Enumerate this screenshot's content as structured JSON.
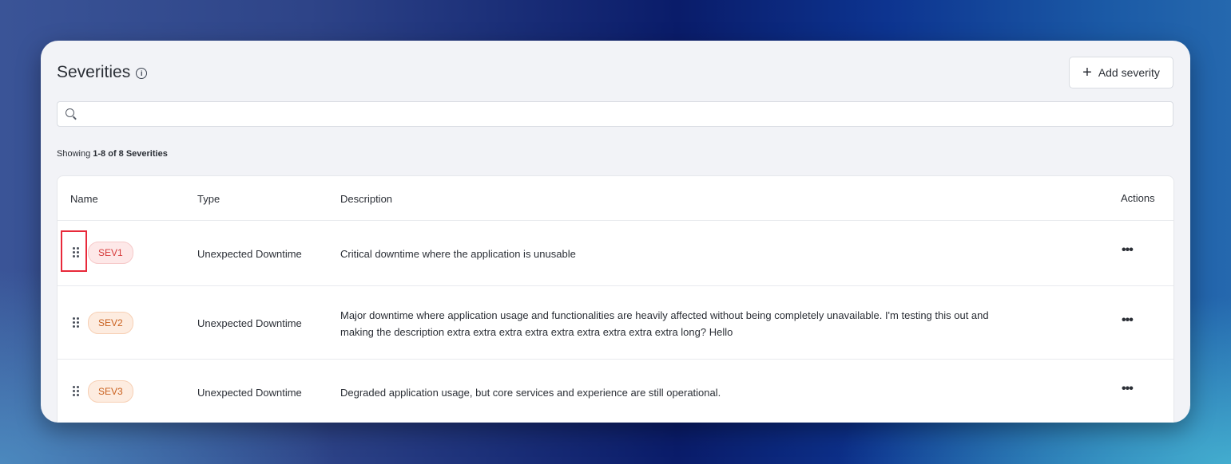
{
  "header": {
    "title": "Severities",
    "add_button_label": "Add severity"
  },
  "search": {
    "placeholder": "",
    "value": ""
  },
  "summary": {
    "prefix": "Showing ",
    "range": "1-8 of 8 Severities"
  },
  "table": {
    "columns": [
      "Name",
      "Type",
      "Description",
      "Actions"
    ],
    "rows": [
      {
        "name": "SEV1",
        "type": "Unexpected Downtime",
        "description": "Critical downtime where the application is unusable",
        "color": "#d63b3b"
      },
      {
        "name": "SEV2",
        "type": "Unexpected Downtime",
        "description_line1": "Major downtime where application usage and functionalities are heavily affected without being completely unavailable. I'm testing this out and",
        "description_line2": "making the description extra extra extra extra extra extra extra extra extra long? Hello",
        "color": "#c9601e"
      },
      {
        "name": "SEV3",
        "type": "Unexpected Downtime",
        "description": "Degraded application usage, but core services and experience are still operational.",
        "color": "#c9601e"
      }
    ]
  }
}
